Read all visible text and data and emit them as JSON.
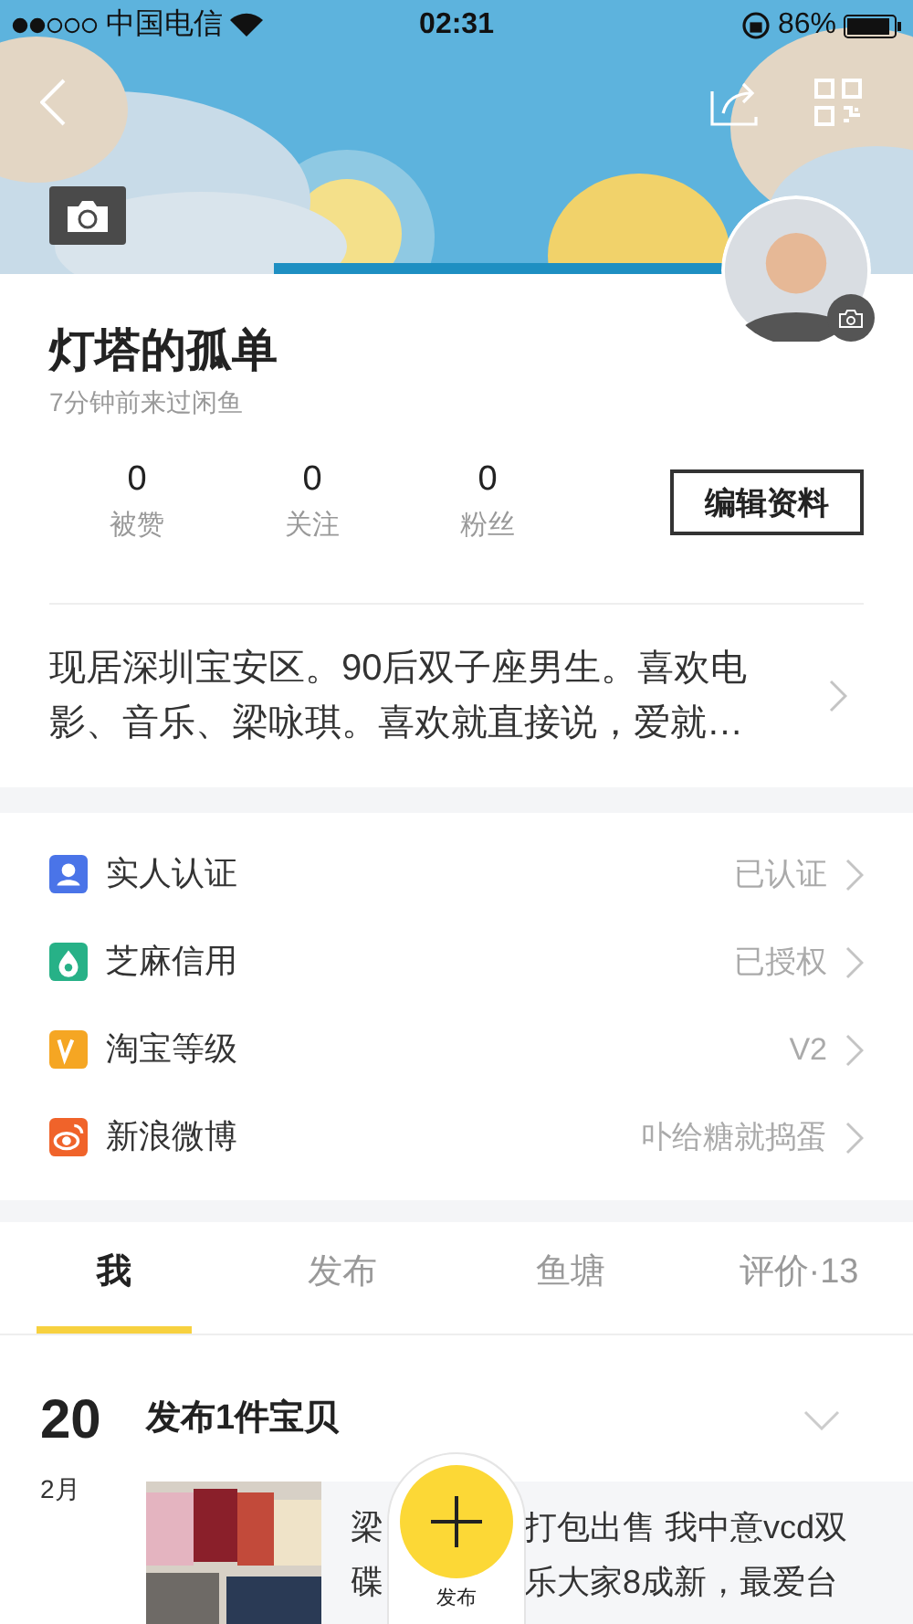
{
  "status_bar": {
    "carrier": "中国电信",
    "time": "02:31",
    "battery": "86%"
  },
  "profile": {
    "name": "灯塔的孤单",
    "last_seen": "7分钟前来过闲鱼",
    "stats": [
      {
        "value": "0",
        "label": "被赞"
      },
      {
        "value": "0",
        "label": "关注"
      },
      {
        "value": "0",
        "label": "粉丝"
      }
    ],
    "edit_button": "编辑资料",
    "bio": "现居深圳宝安区。90后双子座男生。喜欢电影、音乐、梁咏琪。喜欢就直接说，爱就…"
  },
  "verifications": [
    {
      "kind": "identity",
      "label": "实人认证",
      "value": "已认证",
      "color": "#4a74e8"
    },
    {
      "kind": "credit",
      "label": "芝麻信用",
      "value": "已授权",
      "color": "#27b187"
    },
    {
      "kind": "level",
      "label": "淘宝等级",
      "value": "V2",
      "color": "#f5a623"
    },
    {
      "kind": "weibo",
      "label": "新浪微博",
      "value": "卟给糖就捣蛋",
      "color": "#f0632a"
    }
  ],
  "tabs": [
    {
      "label": "我",
      "selected": true
    },
    {
      "label": "发布",
      "selected": false
    },
    {
      "label": "鱼塘",
      "selected": false
    },
    {
      "label": "评价·13",
      "selected": false
    }
  ],
  "timeline": [
    {
      "day": "20",
      "month": "2月",
      "title": "发布1件宝贝",
      "post_lines": [
        {
          "before": "梁",
          "after": "打包出售 我中意vcd双"
        },
        {
          "before": "碟",
          "after": "乐大家8成新，最爱台"
        }
      ]
    }
  ],
  "publish_button": {
    "label": "发布"
  }
}
